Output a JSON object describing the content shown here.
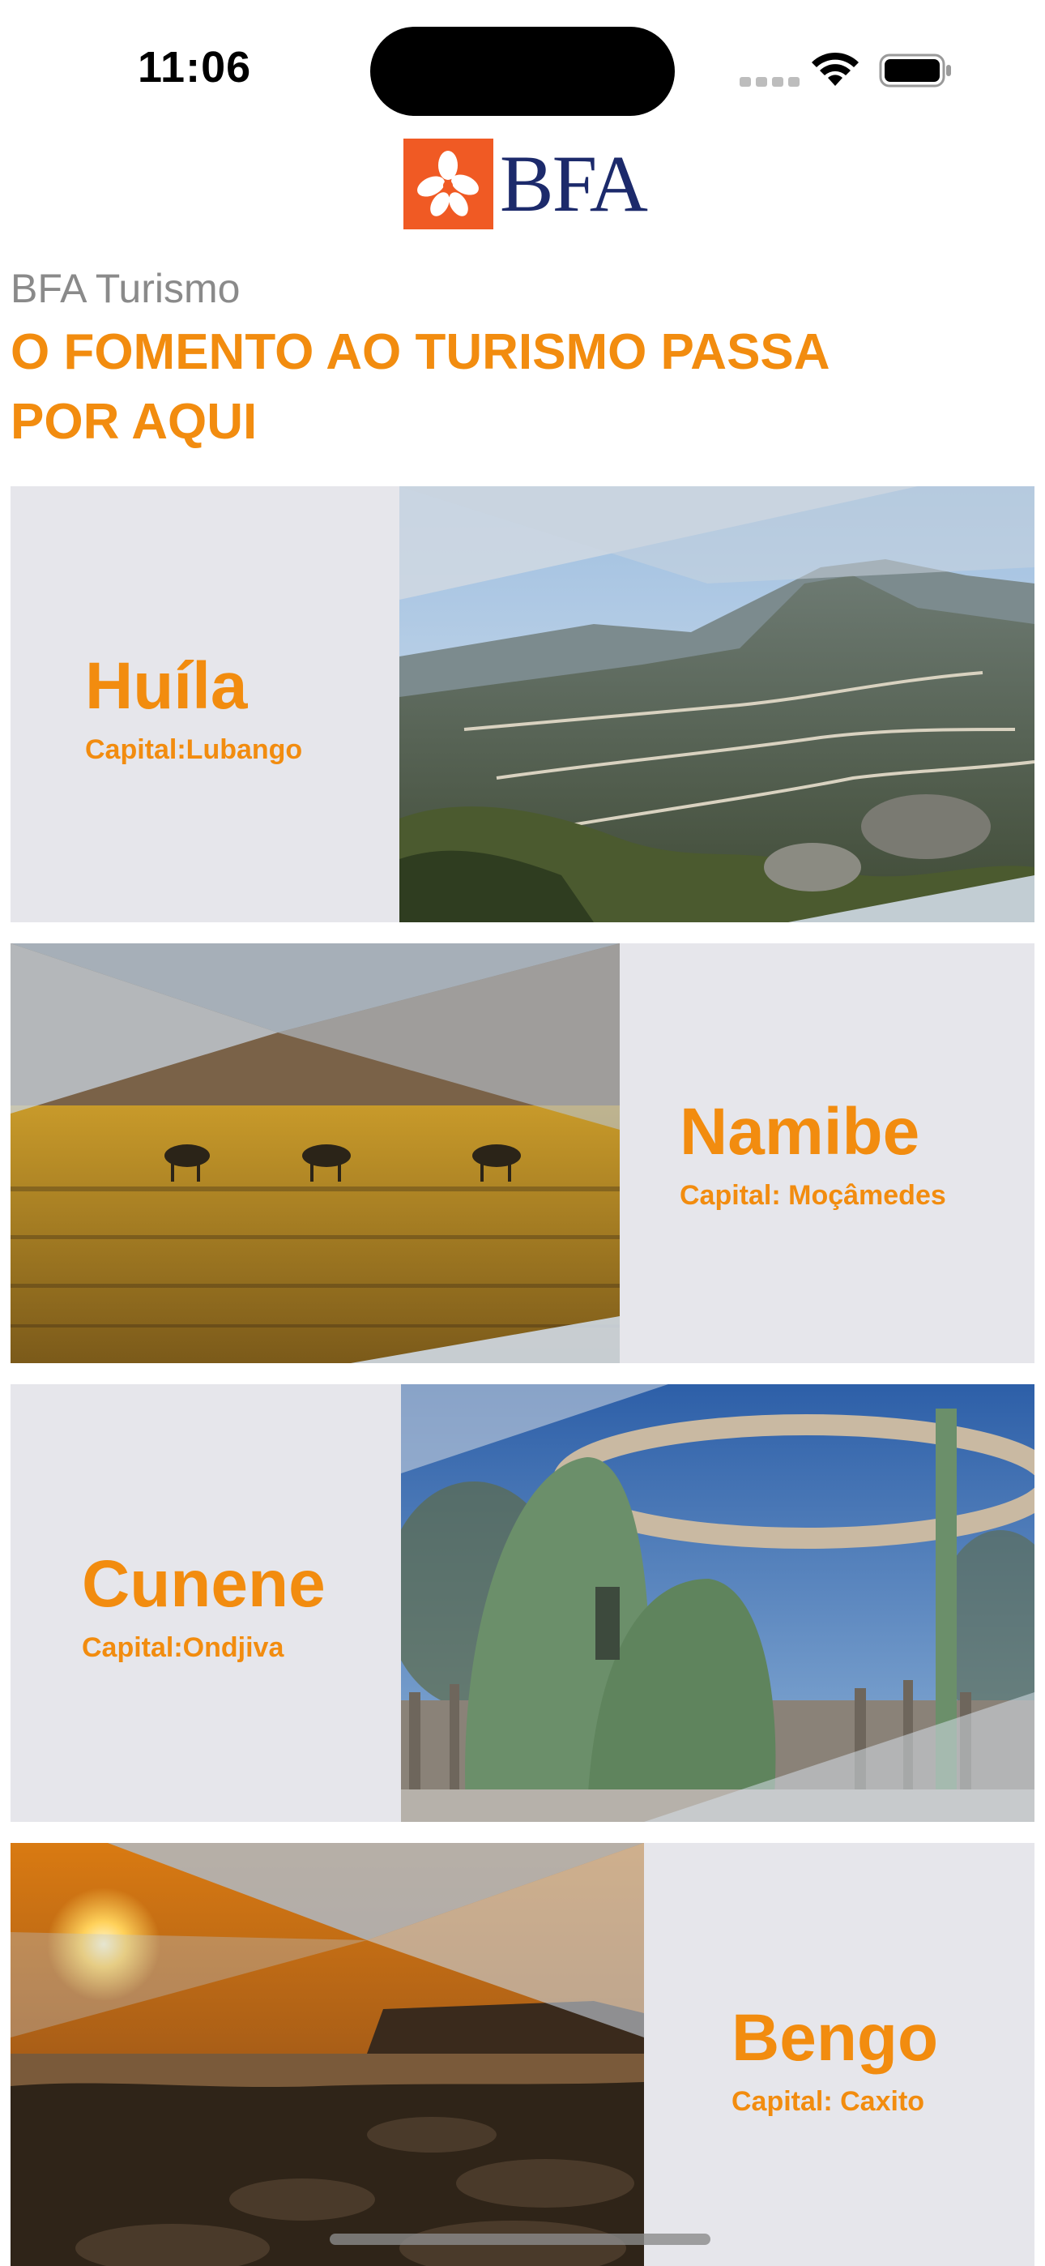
{
  "status_bar": {
    "time": "11:06"
  },
  "logo": {
    "text": "BFA"
  },
  "header": {
    "subtitle": "BFA Turismo",
    "headline": "O FOMENTO AO TURISMO PASSA POR AQUI"
  },
  "cards": [
    {
      "region": "Huíla",
      "capital": "Capital:Lubango"
    },
    {
      "region": "Namibe",
      "capital": "Capital: Moçâmedes"
    },
    {
      "region": "Cunene",
      "capital": "Capital:Ondjiva"
    },
    {
      "region": "Bengo",
      "capital": "Capital: Caxito"
    }
  ],
  "colors": {
    "accent": "#f28c0f",
    "card_bg": "#e6e6eb",
    "subtitle": "#8a8a8a",
    "logo_red": "#f05a24",
    "logo_navy": "#1c2a6b"
  }
}
